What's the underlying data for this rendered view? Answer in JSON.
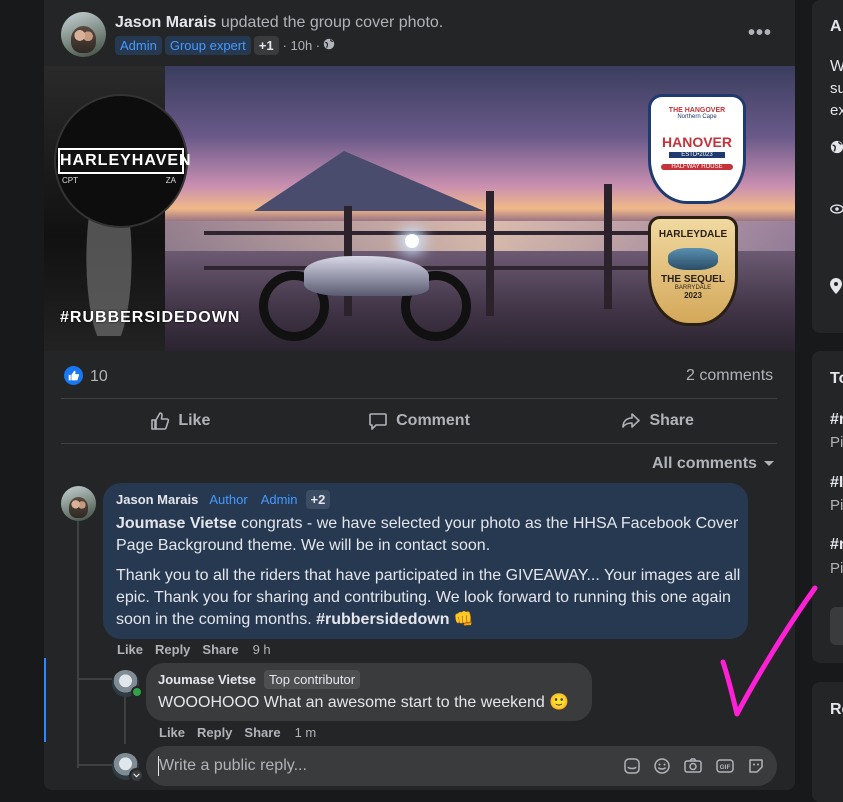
{
  "post": {
    "author": "Jason Marais",
    "action": "updated the group cover photo.",
    "badges": [
      "Admin",
      "Group expert"
    ],
    "extra_badges": "+1",
    "time": "· 10h ·",
    "more_label": "•••"
  },
  "cover": {
    "left_logo": "HARLEYHAVEN",
    "left_logo_left": "CPT",
    "left_logo_right": "ZA",
    "hashtag": "#RUBBERSIDEDOWN",
    "hanover_top": "THE HANGOVER",
    "hanover_sub": "Northern Cape",
    "hanover_name": "HANOVER",
    "hanover_est": "ESTD•2023",
    "hanover_bottom": "HALFWAY HOUSE",
    "harleydale_name": "HARLEYDALE",
    "harleydale_sequel": "THE SEQUEL",
    "harleydale_place": "BARRYDALE",
    "harleydale_year": "2023"
  },
  "stats": {
    "likes": "10",
    "comments": "2 comments"
  },
  "actions": {
    "like": "Like",
    "comment": "Comment",
    "share": "Share"
  },
  "sort": "All comments",
  "comment1": {
    "author": "Jason Marais",
    "badges": [
      "Author",
      "Admin"
    ],
    "extra": "+2",
    "mention": "Joumase Vietse",
    "line1": " congrats - we have selected your photo as the HHSA Facebook Cover Page Background theme. We will be in contact soon.",
    "line2": "Thank you to all the riders that have participated in the GIVEAWAY... Your images are all epic. Thank you for sharing and contributing. We look forward to running this one again soon in the coming months. ",
    "hashtag": "#rubbersidedown",
    "emoji": "👊",
    "like": "Like",
    "reply": "Reply",
    "share": "Share",
    "time": "9 h"
  },
  "comment2": {
    "author": "Joumase Vietse",
    "badge": "Top contributor",
    "text": "WOOOHOOO What an awesome start to the weekend ",
    "emoji": "🙂",
    "like": "Like",
    "reply": "Reply",
    "share": "Share",
    "time": "1 m"
  },
  "reply_box": {
    "placeholder": "Write a public reply..."
  },
  "right_sidebar": {
    "card1_title_initial": "A",
    "card1_line1": "W",
    "card1_line2": "su",
    "card1_line3": "ex",
    "card2_title_initial": "To",
    "items": [
      "#r",
      "Pi",
      "#I",
      "Pi",
      "#r",
      "Pi"
    ],
    "card3_title_initial": "Re"
  },
  "colors": {
    "accent": "#1877f2",
    "badge_blue": "#4599ff",
    "comment_bubble": "#263951",
    "checkmark": "#ff1fd6"
  }
}
